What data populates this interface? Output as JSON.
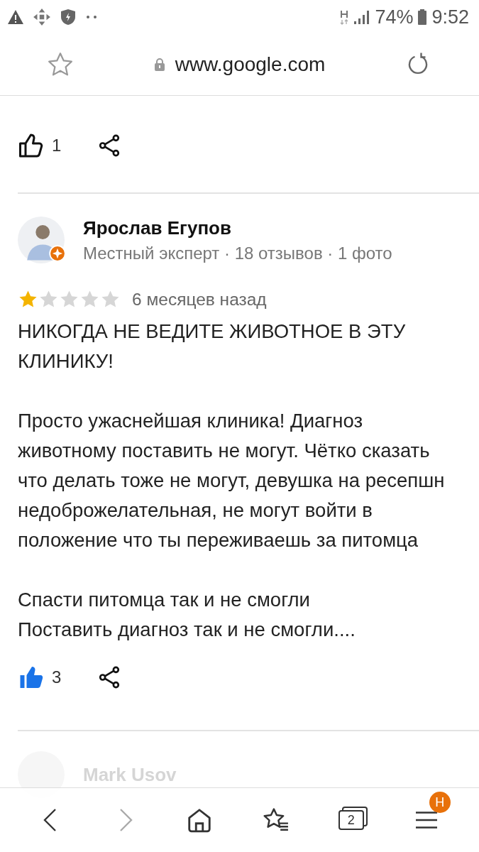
{
  "status_bar": {
    "battery": "74%",
    "time": "9:52"
  },
  "address_bar": {
    "url": "www.google.com"
  },
  "prev_review": {
    "likes": "1",
    "liked": false
  },
  "review": {
    "author": "Ярослав Егупов",
    "meta": "Местный эксперт · 18 отзывов · 1 фото",
    "stars": 1,
    "time": "6 месяцев назад",
    "paragraphs": [
      [
        "НИКОГДА НЕ ВЕДИТЕ ЖИВОТНОЕ В ЭТУ КЛИНИКУ!"
      ],
      [
        "Просто ужаснейшая клиника! Диагноз животному поставить не могут. Чётко сказать что делать тоже не могут, девушка на ресепшн недоброжелательная, не могут войти в положение что ты переживаешь за питомца"
      ],
      [
        "Спасти питомца так и не смогли",
        "Поставить диагноз так и не смогли...."
      ]
    ],
    "likes": "3",
    "liked": true
  },
  "next_review": {
    "author": "Mark Usov"
  },
  "bottom_bar": {
    "tabs_count": "2",
    "menu_badge": "Н"
  }
}
